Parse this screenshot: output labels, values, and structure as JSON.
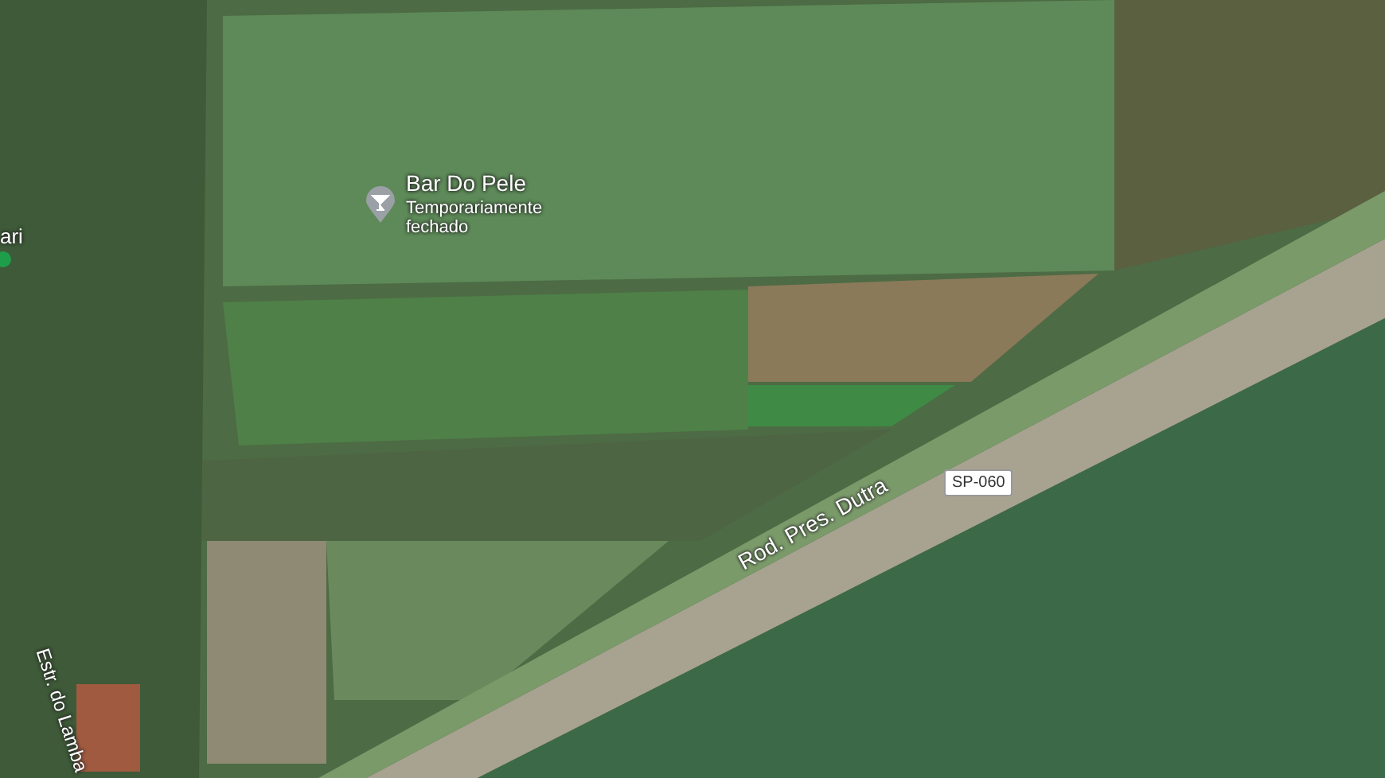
{
  "map": {
    "places": [
      {
        "name": "Bar Do Pele",
        "status": "Temporariamente fechado"
      }
    ],
    "edge_place": {
      "name": "ari"
    },
    "roads": [
      {
        "kind": "shield",
        "text": "SP-060"
      },
      {
        "kind": "highway",
        "text": "Rod. Pres. Dutra"
      },
      {
        "kind": "street",
        "text": "Estr. do Lamba"
      }
    ]
  }
}
